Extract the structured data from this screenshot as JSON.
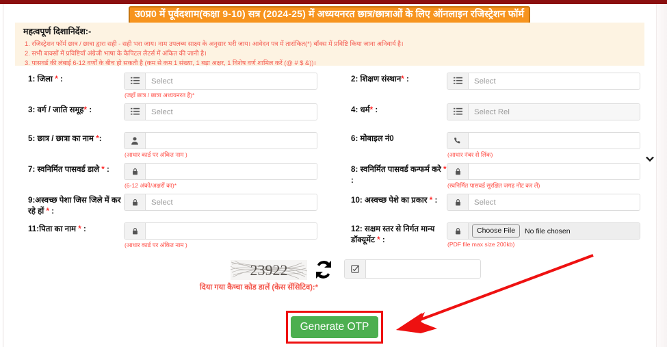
{
  "header": {
    "title": "उ0प्र0 में पूर्वदशाम(कक्षा 9-10) सत्र (2024-25) में अध्ययनरत छात्र/छात्राओं के लिए ऑनलाइन रजिस्ट्रेशन फॉर्म",
    "banner_bg": "#f7941e",
    "banner_border": "#c8760f",
    "banner_text_color": "#ffffff"
  },
  "instructions": {
    "heading": "महत्वपूर्ण दिशानिर्देश:-",
    "panel_bg": "#fdf3e2",
    "text_color": "#f4594f",
    "lines": [
      "1. रजिस्ट्रेशन फॉर्म छात्र / छात्रा द्वारा सही - सही भरा जाय। नाम उपलब्ध साक्ष्य के अनुसार भरी जाय। आवेदन पत्र में तारांकित(*) बॉक्स में प्रविष्टि किया जाना अनिवार्य है।",
      "2. सभी बाक्सों में प्रविष्टियाँ अंग्रेजी भाषा के कैपिटल लैटर्स में अंकित की जानी है।",
      "3. पासवर्ड की लंबाई 6-12 वर्णों के बीच हो सकती है (कम से कम 1 संख्या, 1 बड़ा अक्षर, 1 विशेष वर्ण शामिल करें (@ # $ &))।"
    ]
  },
  "fields": [
    {
      "id": "district",
      "label": "1: जिला ",
      "required": true,
      "label_suffix": " :",
      "control": "select",
      "icon": "list-icon",
      "value": "Select",
      "hint": "(जहाँ छात्र / छात्रा अध्ययनरत है)*"
    },
    {
      "id": "institution",
      "label": "2: शिक्षण संस्थान",
      "required": true,
      "label_suffix": " :",
      "control": "select",
      "icon": "list-icon",
      "value": "Select",
      "hint": ""
    },
    {
      "id": "caste-group",
      "label": "3: वर्ग / जाति समूह",
      "required": true,
      "label_suffix": " :",
      "control": "select",
      "icon": "list-icon",
      "value": "Select",
      "hint": ""
    },
    {
      "id": "religion",
      "label": "4: धर्म",
      "required": true,
      "label_suffix": " :",
      "control": "select",
      "icon": "list-icon",
      "value": "Select Rel",
      "hint": ""
    },
    {
      "id": "student-name",
      "label": "5: छात्र / छात्रा का नाम ",
      "required": true,
      "label_suffix": ":",
      "control": "text",
      "icon": "user-icon",
      "value": "",
      "hint": "(आधार कार्ड पर अंकित नाम )"
    },
    {
      "id": "mobile-number",
      "label": "6: मोबाइल नं0",
      "required": false,
      "label_suffix": "",
      "control": "text",
      "icon": "phone-icon",
      "value": "",
      "hint": "(आधार नंबर से लिंक)"
    },
    {
      "id": "password",
      "label": "7: स्वनिर्मित पासवर्ड डाले ",
      "required": true,
      "label_suffix": " :",
      "control": "password",
      "icon": "lock-icon",
      "value": "",
      "hint": "(6-12 अंको/अक्षरों का)*"
    },
    {
      "id": "confirm-password",
      "label": "8: स्वनिर्मित पासवर्ड कन्फर्म करे ",
      "required": true,
      "label_suffix": " :",
      "control": "password",
      "icon": "lock-icon",
      "value": "",
      "hint": "(स्वनिर्मित पासवर्ड सुरक्षित जगह नोट कर लें)"
    },
    {
      "id": "unclean-occupation-district",
      "label": "9:अस्वच्छ पेशा जिस जिले में कर रहे हों ",
      "required": true,
      "label_suffix": " :",
      "control": "select",
      "icon": "lock-icon",
      "value": "Select",
      "hint": ""
    },
    {
      "id": "unclean-occupation-type",
      "label": "10: अस्वच्छ पेशे का प्रकार ",
      "required": true,
      "label_suffix": " :",
      "control": "select",
      "icon": "lock-icon",
      "value": "Select",
      "hint": ""
    },
    {
      "id": "father-name",
      "label": "11:पिता का नाम ",
      "required": true,
      "label_suffix": " :",
      "control": "text",
      "icon": "lock-icon",
      "value": "",
      "hint": "(आधार कार्ड पर अंकित नाम )"
    },
    {
      "id": "document-upload",
      "label": "12: सक्षम स्तर से निर्गत मान्य डॉक्यूमेंट ",
      "required": true,
      "label_suffix": " :",
      "control": "file",
      "icon": "lock-icon",
      "file_button": "Choose File",
      "file_status": "No file chosen",
      "hint": "(PDF file max size 200kb)"
    }
  ],
  "captcha": {
    "code": "23922",
    "refresh_icon": "refresh-icon",
    "label": "दिया गया कैप्चा कोड डालें (केस सेंसिटिव):*",
    "input_icon": "check-square-icon",
    "input_value": ""
  },
  "submit": {
    "label": "Generate OTP",
    "button_color": "#4caf50",
    "highlight_color": "#ee1111"
  },
  "annotation": {
    "arrow_color": "#ee1111"
  }
}
